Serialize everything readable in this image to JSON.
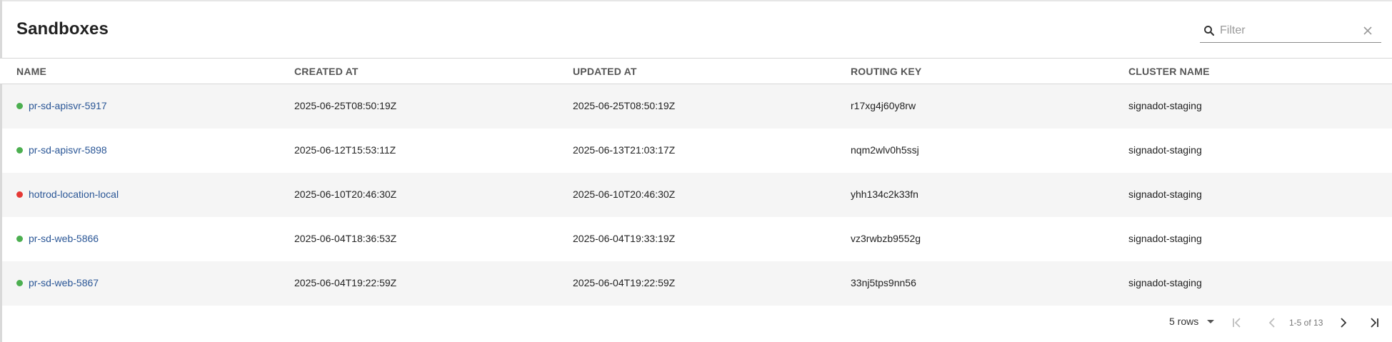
{
  "header": {
    "title": "Sandboxes",
    "filter_placeholder": "Filter",
    "filter_value": ""
  },
  "columns": {
    "name": "NAME",
    "created_at": "CREATED AT",
    "updated_at": "UPDATED AT",
    "routing_key": "ROUTING KEY",
    "cluster_name": "CLUSTER NAME"
  },
  "colors": {
    "status_ready": "#4caf50",
    "status_failed": "#e53935",
    "link": "#2a5696",
    "row_alt": "#f5f5f5"
  },
  "rows": [
    {
      "status": "ready",
      "name": "pr-sd-apisvr-5917",
      "created_at": "2025-06-25T08:50:19Z",
      "updated_at": "2025-06-25T08:50:19Z",
      "routing_key": "r17xg4j60y8rw",
      "cluster_name": "signadot-staging"
    },
    {
      "status": "ready",
      "name": "pr-sd-apisvr-5898",
      "created_at": "2025-06-12T15:53:11Z",
      "updated_at": "2025-06-13T21:03:17Z",
      "routing_key": "nqm2wlv0h5ssj",
      "cluster_name": "signadot-staging"
    },
    {
      "status": "failed",
      "name": "hotrod-location-local",
      "created_at": "2025-06-10T20:46:30Z",
      "updated_at": "2025-06-10T20:46:30Z",
      "routing_key": "yhh134c2k33fn",
      "cluster_name": "signadot-staging"
    },
    {
      "status": "ready",
      "name": "pr-sd-web-5866",
      "created_at": "2025-06-04T18:36:53Z",
      "updated_at": "2025-06-04T19:33:19Z",
      "routing_key": "vz3rwbzb9552g",
      "cluster_name": "signadot-staging"
    },
    {
      "status": "ready",
      "name": "pr-sd-web-5867",
      "created_at": "2025-06-04T19:22:59Z",
      "updated_at": "2025-06-04T19:22:59Z",
      "routing_key": "33nj5tps9nn56",
      "cluster_name": "signadot-staging"
    }
  ],
  "pagination": {
    "rows_per_page": "5 rows",
    "range_label": "1-5 of 13"
  },
  "icons": {
    "search": "search-icon",
    "clear": "close-icon",
    "rows_dropdown": "chevron-down-icon",
    "first": "first-page-icon",
    "prev": "chevron-left-icon",
    "next": "chevron-right-icon",
    "last": "last-page-icon"
  }
}
